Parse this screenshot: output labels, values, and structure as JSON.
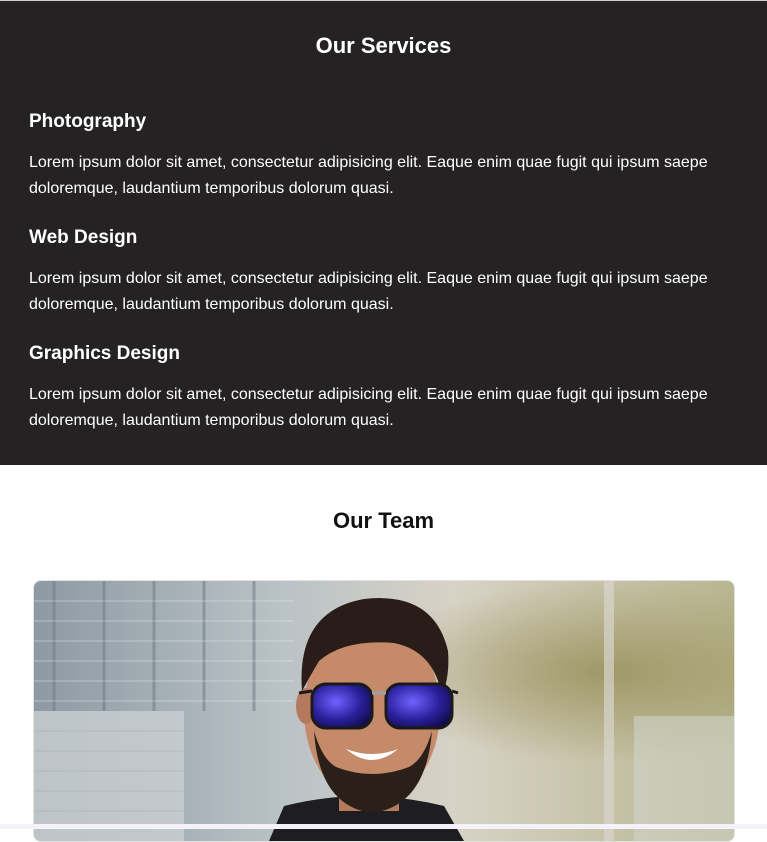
{
  "services": {
    "title": "Our Services",
    "items": [
      {
        "heading": "Photography",
        "text": "Lorem ipsum dolor sit amet, consectetur adipisicing elit. Eaque enim quae fugit qui ipsum saepe doloremque, laudantium temporibus dolorum quasi."
      },
      {
        "heading": "Web Design",
        "text": "Lorem ipsum dolor sit amet, consectetur adipisicing elit. Eaque enim quae fugit qui ipsum saepe doloremque, laudantium temporibus dolorum quasi."
      },
      {
        "heading": "Graphics Design",
        "text": "Lorem ipsum dolor sit amet, consectetur adipisicing elit. Eaque enim quae fugit qui ipsum saepe doloremque, laudantium temporibus dolorum quasi."
      }
    ]
  },
  "team": {
    "title": "Our Team"
  },
  "colors": {
    "services_bg": "#242223",
    "text_light": "#ffffff",
    "text_dark": "#111111"
  }
}
